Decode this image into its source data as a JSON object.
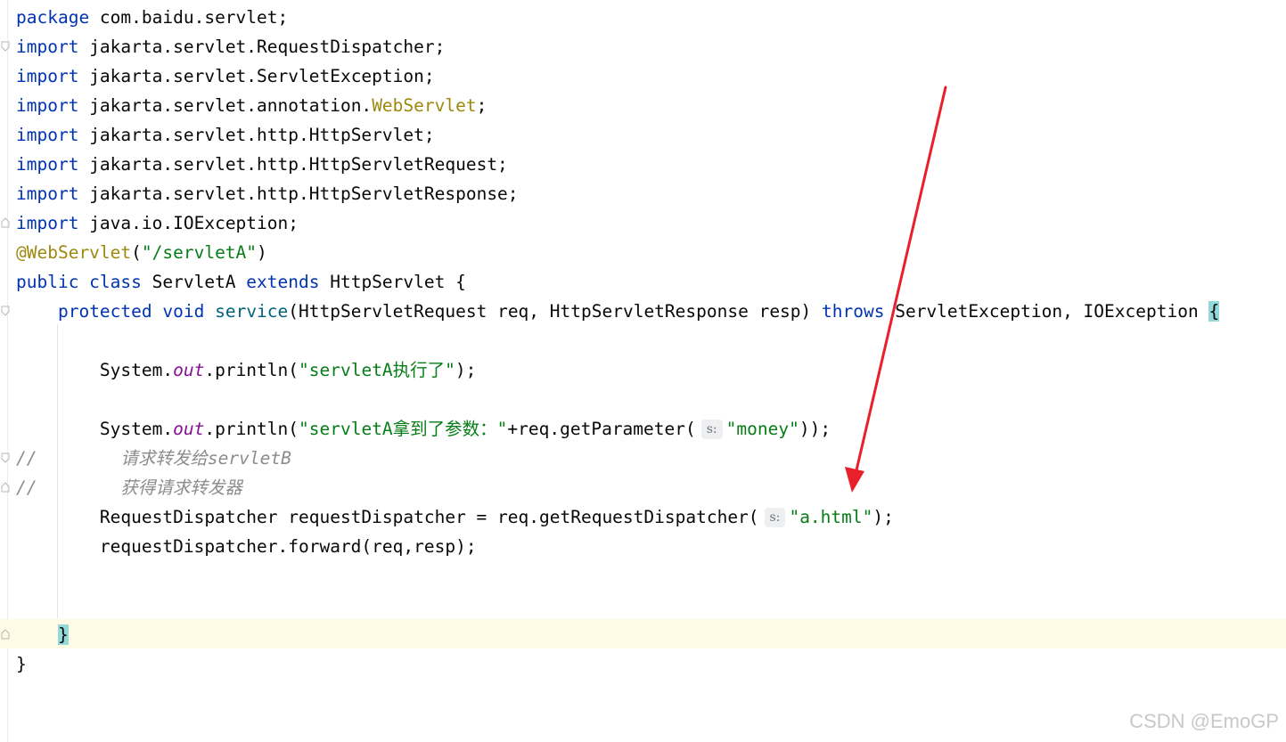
{
  "editor": {
    "lines": {
      "l1": {
        "kw": "package",
        "rest": " com.baidu.servlet;"
      },
      "l2": {
        "kw": "import",
        "rest": " jakarta.servlet.RequestDispatcher;"
      },
      "l3": {
        "kw": "import",
        "rest": " jakarta.servlet.ServletException;"
      },
      "l4": {
        "kw": "import",
        "rest": " jakarta.servlet.annotation.",
        "ann": "WebServlet",
        "end": ";"
      },
      "l5": {
        "kw": "import",
        "rest": " jakarta.servlet.http.HttpServlet;"
      },
      "l6": {
        "kw": "import",
        "rest": " jakarta.servlet.http.HttpServletRequest;"
      },
      "l7": {
        "kw": "import",
        "rest": " jakarta.servlet.http.HttpServletResponse;"
      },
      "l8": {
        "kw": "import",
        "rest": " java.io.IOException;"
      },
      "l9": {
        "ann": "@WebServlet",
        "p1": "(",
        "str": "\"/servletA\"",
        "p2": ")"
      },
      "l10": {
        "kw1": "public class",
        "name": " ServletA ",
        "kw2": "extends",
        "rest": " HttpServlet {"
      },
      "l11": {
        "kw1": "protected void",
        "method": "service",
        "params": "(HttpServletRequest req, HttpServletResponse resp) ",
        "kw2": "throws",
        "rest": " ServletException, IOException ",
        "brace": "{"
      },
      "l13": {
        "pre": "System.",
        "field": "out",
        "mid": ".println(",
        "str": "\"servletA执行了\"",
        "end": ");"
      },
      "l15": {
        "pre": "System.",
        "field": "out",
        "mid": ".println(",
        "str1": "\"servletA拿到了参数：\"",
        "mid2": "+req.getParameter(",
        "hint": "s:",
        "str2": "\"money\"",
        "end": "));"
      },
      "l16": {
        "c1": "//",
        "c2": "请求转发给servletB"
      },
      "l17": {
        "c1": "//",
        "c2": "获得请求转发器"
      },
      "l18": {
        "pre": "RequestDispatcher requestDispatcher = req.getRequestDispatcher(",
        "hint": "s:",
        "str": "\"a.html\"",
        "end": ");"
      },
      "l19": {
        "text": "requestDispatcher.forward(req,resp);"
      },
      "l22": {
        "brace": "}"
      },
      "l23": {
        "brace": "}"
      }
    }
  },
  "annotation": {
    "arrow_color": "#e8202a"
  },
  "watermark": {
    "text": "CSDN @EmoGP"
  }
}
